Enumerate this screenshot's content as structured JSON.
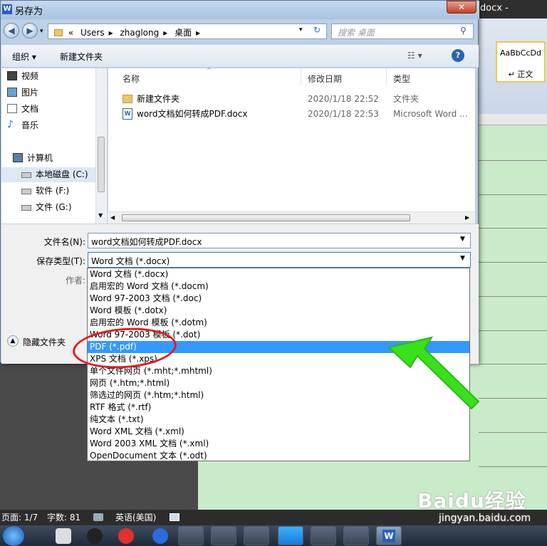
{
  "word_window": {
    "title": "docx - Microsoft",
    "style_sample": "AaBbCcDd",
    "style_name": "正文"
  },
  "status_bar": {
    "page": "页面: 1/7",
    "word_count": "字数: 81",
    "language": "英语(美国)"
  },
  "dialog": {
    "title": "另存为",
    "close_label": "✕",
    "breadcrumb": [
      "«",
      "Users",
      "zhaglong",
      "桌面"
    ],
    "search_placeholder": "搜索 桌面",
    "toolbar": {
      "organize": "组织 ▾",
      "new_folder": "新建文件夹"
    },
    "nav_items": [
      {
        "label": "视频",
        "icon": "video-icon"
      },
      {
        "label": "图片",
        "icon": "picture-icon"
      },
      {
        "label": "文档",
        "icon": "document-icon"
      },
      {
        "label": "音乐",
        "icon": "music-icon"
      },
      {
        "label": "计算机",
        "icon": "computer-icon"
      },
      {
        "label": "本地磁盘 (C:)",
        "icon": "drive-icon"
      },
      {
        "label": "软件 (F:)",
        "icon": "drive-icon"
      },
      {
        "label": "文件 (G:)",
        "icon": "drive-icon"
      }
    ],
    "columns": {
      "name": "名称",
      "modified": "修改日期",
      "type": "类型"
    },
    "files": [
      {
        "name": "新建文件夹",
        "modified": "2020/1/18 22:52",
        "type": "文件夹",
        "icon": "folder-icon"
      },
      {
        "name": "word文档如何转成PDF.docx",
        "modified": "2020/1/18 22:53",
        "type": "Microsoft Word ...",
        "icon": "word-doc-icon"
      }
    ],
    "filename_label": "文件名(N):",
    "filename_value": "word文档如何转成PDF.docx",
    "savetype_label": "保存类型(T):",
    "savetype_value": "Word 文档 (*.docx)",
    "author_label": "作者:",
    "hide_folders": "隐藏文件夹",
    "save_types": [
      "Word 文档 (*.docx)",
      "启用宏的 Word 文档 (*.docm)",
      "Word 97-2003 文档 (*.doc)",
      "Word 模板 (*.dotx)",
      "启用宏的 Word 模板 (*.dotm)",
      "Word 97-2003 模板 (*.dot)",
      "PDF (*.pdf)",
      "XPS 文档 (*.xps)",
      "单个文件网页 (*.mht;*.mhtml)",
      "网页 (*.htm;*.html)",
      "筛选过的网页 (*.htm;*.html)",
      "RTF 格式 (*.rtf)",
      "纯文本 (*.txt)",
      "Word XML 文档 (*.xml)",
      "Word 2003 XML 文档 (*.xml)",
      "OpenDocument 文本 (*.odt)"
    ],
    "selected_index": 6
  },
  "watermark": {
    "brand": "Baidu经验",
    "url": "jingyan.baidu.com"
  },
  "colors": {
    "selection": "#3399ff",
    "annotation_red": "#e21d1d",
    "annotation_green": "#39e01b",
    "doc_bg": "#c9ebc9"
  }
}
